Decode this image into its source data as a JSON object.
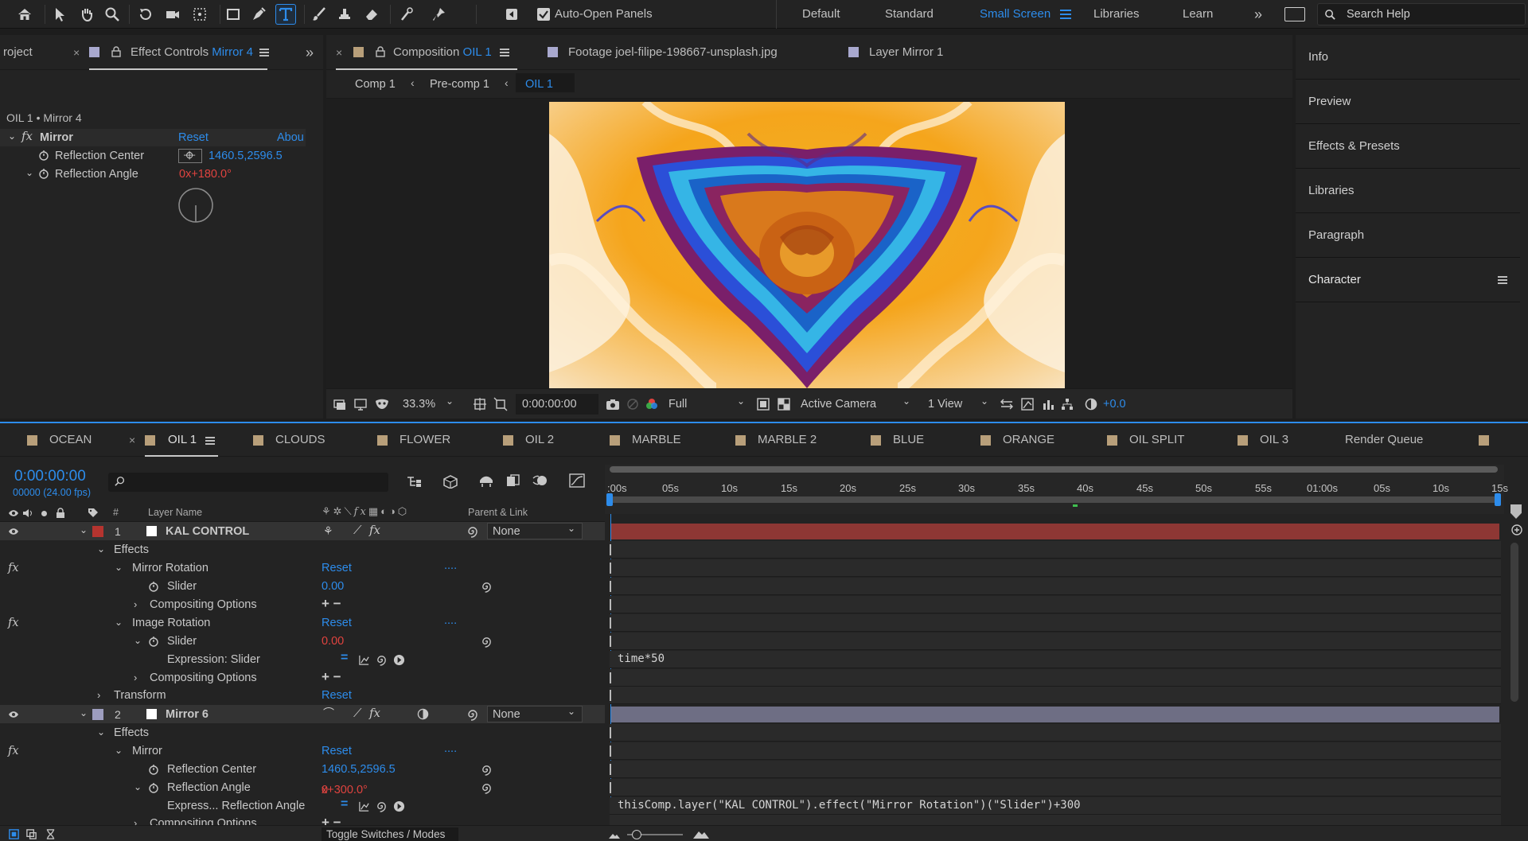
{
  "toolbar": {
    "auto_open_label": "Auto-Open Panels",
    "workspaces": [
      "Default",
      "Standard",
      "Small Screen",
      "Libraries",
      "Learn"
    ],
    "active_workspace": "Small Screen",
    "search_placeholder": "Search Help"
  },
  "left_panel": {
    "tab_project": "roject",
    "tab_effect_controls_prefix": "Effect Controls",
    "tab_effect_controls_layer": "Mirror 4",
    "breadcrumb": "OIL 1 • Mirror 4",
    "effect_name": "Mirror",
    "reset_label": "Reset",
    "about_label": "Abou",
    "reflection_center_label": "Reflection Center",
    "reflection_center_value": "1460.5,2596.5",
    "reflection_angle_label": "Reflection Angle",
    "reflection_angle_rev": "0",
    "reflection_angle_deg": "x+180.0°"
  },
  "comp_panel": {
    "tab_composition_prefix": "Composition",
    "tab_composition_name": "OIL 1",
    "tab_footage": "Footage joel-filipe-198667-unsplash.jpg",
    "tab_layer": "Layer Mirror 1",
    "crumbs": [
      "Comp 1",
      "Pre-comp 1",
      "OIL 1"
    ],
    "zoom": "33.3%",
    "timecode": "0:00:00:00",
    "resolution": "Full",
    "camera": "Active Camera",
    "view": "1 View",
    "exposure": "+0.0"
  },
  "right_panel": {
    "items": [
      "Info",
      "Preview",
      "Effects & Presets",
      "Libraries",
      "Paragraph",
      "Character"
    ]
  },
  "timeline": {
    "tabs": [
      "OCEAN",
      "OIL 1",
      "CLOUDS",
      "FLOWER",
      "OIL 2",
      "MARBLE",
      "MARBLE 2",
      "BLUE",
      "ORANGE",
      "OIL SPLIT",
      "OIL 3",
      "Render Queue"
    ],
    "active_tab": "OIL 1",
    "current_time": "0:00:00:00",
    "frame_info": "00000 (24.00 fps)",
    "col_hash": "#",
    "col_layer_name": "Layer Name",
    "col_parent": "Parent & Link",
    "ruler": [
      ":00s",
      "05s",
      "10s",
      "15s",
      "20s",
      "25s",
      "30s",
      "35s",
      "40s",
      "45s",
      "50s",
      "55s",
      "01:00s",
      "05s",
      "10s",
      "15s"
    ],
    "layer1": {
      "index": "1",
      "name": "KAL CONTROL",
      "parent": "None",
      "color": "#b5342f",
      "effects_label": "Effects",
      "mirror_rotation": "Mirror Rotation",
      "reset": "Reset",
      "dots": "....",
      "slider_label": "Slider",
      "slider1_value": "0.00",
      "compositing_options": "Compositing Options",
      "image_rotation": "Image Rotation",
      "slider2_value": "0.00",
      "expression_label": "Expression: Slider",
      "expression_text": "time*50",
      "transform_label": "Transform",
      "transform_reset": "Reset"
    },
    "layer2": {
      "index": "2",
      "name": "Mirror 6",
      "parent": "None",
      "color": "#9d9dbe",
      "effects_label": "Effects",
      "mirror_label": "Mirror",
      "reset": "Reset",
      "dots": "....",
      "reflection_center_label": "Reflection Center",
      "reflection_center_value": "1460.5,2596.5",
      "reflection_angle_label": "Reflection Angle",
      "reflection_angle_rev": "0",
      "reflection_angle_deg": "x+300.0°",
      "expression_label": "Express... Reflection Angle",
      "expression_text": "thisComp.layer(\"KAL CONTROL\").effect(\"Mirror Rotation\")(\"Slider\")+300",
      "compositing_options": "Compositing Options"
    },
    "toggle_label": "Toggle Switches / Modes"
  },
  "colors": {
    "accent_blue": "#2d8ceb",
    "value_red": "#e0433f",
    "layer1_bar": "#8e3734",
    "layer2_bar": "#6e6e84"
  }
}
